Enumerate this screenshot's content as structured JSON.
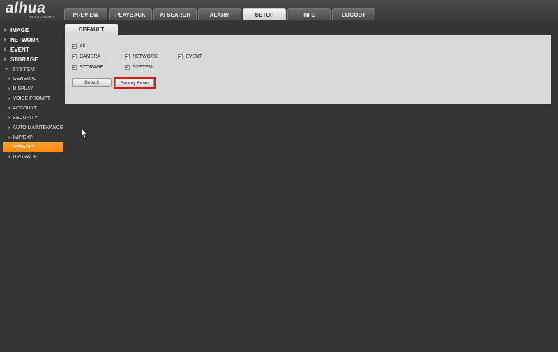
{
  "brand": {
    "logo_text": "alhua",
    "logo_subtext": "TECHNOLOGY"
  },
  "nav": {
    "tabs": [
      {
        "label": "PREVIEW"
      },
      {
        "label": "PLAYBACK"
      },
      {
        "label": "AI SEARCH"
      },
      {
        "label": "ALARM"
      },
      {
        "label": "SETUP",
        "active": true
      },
      {
        "label": "INFO"
      },
      {
        "label": "LOGOUT"
      }
    ]
  },
  "sidebar": {
    "categories": [
      {
        "label": "IMAGE"
      },
      {
        "label": "NETWORK"
      },
      {
        "label": "EVENT"
      },
      {
        "label": "STORAGE"
      },
      {
        "label": "SYSTEM",
        "expanded": true
      }
    ],
    "system_items": [
      {
        "label": "GENERAL"
      },
      {
        "label": "DISPLAY"
      },
      {
        "label": "VOICE PROMPT"
      },
      {
        "label": "ACCOUNT"
      },
      {
        "label": "SECURITY"
      },
      {
        "label": "AUTO MAINTENANCE"
      },
      {
        "label": "IMP/EXP"
      },
      {
        "label": "DEFAULT",
        "active": true
      },
      {
        "label": "UPGRADE"
      }
    ]
  },
  "content": {
    "tab_label": "DEFAULT",
    "checkboxes": {
      "all": {
        "label": "All",
        "checked": true
      },
      "camera": {
        "label": "CAMERA",
        "checked": true
      },
      "network": {
        "label": "NETWORK",
        "checked": true
      },
      "event": {
        "label": "EVENT",
        "checked": true
      },
      "storage": {
        "label": "STORAGE",
        "checked": true
      },
      "system": {
        "label": "SYSTEM",
        "checked": true
      }
    },
    "default_button": "Default",
    "factory_reset_button": "Factory Reset",
    "check_glyph": "✓"
  },
  "colors": {
    "accent": "#ff8c1a",
    "highlight": "#d21a1a"
  }
}
